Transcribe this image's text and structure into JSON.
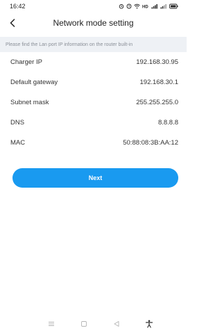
{
  "status_bar": {
    "time": "16:42",
    "icons": [
      "alarm-icon",
      "clock-icon",
      "wifi-icon",
      "hd-icon",
      "signal-icon",
      "signal-icon",
      "battery-icon"
    ]
  },
  "header": {
    "title": "Network mode setting",
    "back_icon": "back-arrow-icon"
  },
  "notice": "Please find the Lan port IP information on the router built-in",
  "info_rows": [
    {
      "label": "Charger IP",
      "value": "192.168.30.95"
    },
    {
      "label": "Default gateway",
      "value": "192.168.30.1"
    },
    {
      "label": "Subnet mask",
      "value": "255.255.255.0"
    },
    {
      "label": "DNS",
      "value": "8.8.8.8"
    },
    {
      "label": "MAC",
      "value": "50:88:08:3B:AA:12"
    }
  ],
  "next_button": {
    "label": "Next",
    "color": "#199af0"
  },
  "nav_bar": {
    "items": [
      "menu-icon",
      "home-square-icon",
      "back-triangle-icon",
      "accessibility-icon"
    ]
  }
}
